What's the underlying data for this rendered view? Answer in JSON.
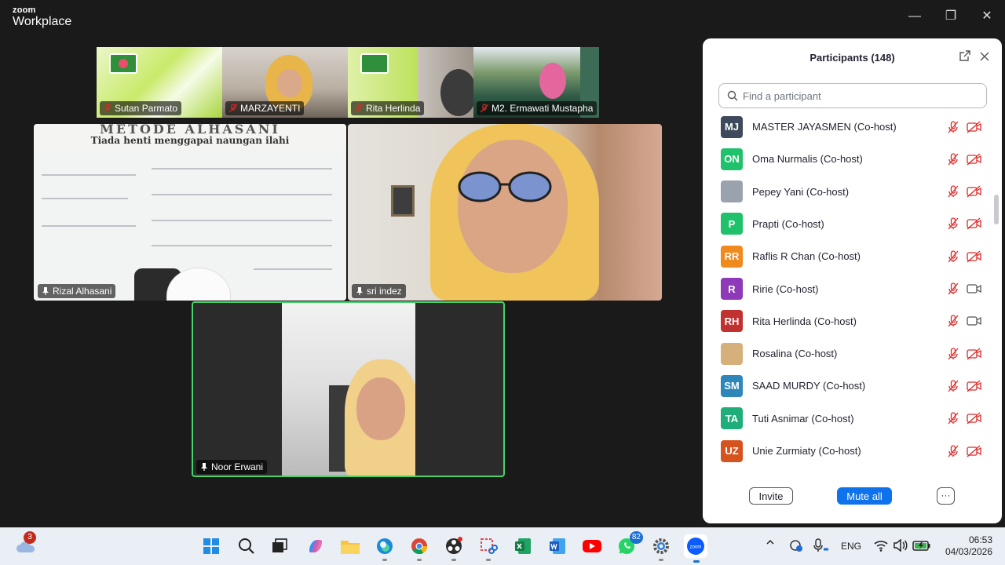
{
  "app": {
    "brand_small": "zoom",
    "brand_big": "Workplace"
  },
  "window_controls": {
    "minimize": "—",
    "restore": "❐",
    "close": "✕"
  },
  "strip_tiles": [
    {
      "name": "Sutan Parmato"
    },
    {
      "name": "MARZAYENTI"
    },
    {
      "name": "Rita Herlinda"
    },
    {
      "name": "M2. Ermawati Mustapha"
    }
  ],
  "main_tiles": {
    "rizal": {
      "name": "Rizal Alhasani",
      "banner_line1": "METODE ALHASANI",
      "banner_line2": "Tiada henti menggapai naungan ilahi"
    },
    "sri": {
      "name": "sri indez"
    },
    "noor": {
      "name": "Noor Erwani"
    }
  },
  "panel": {
    "title": "Participants (148)",
    "search_placeholder": "Find a participant",
    "invite_label": "Invite",
    "mute_all_label": "Mute all",
    "more_label": "···",
    "participants": [
      {
        "initials": "MJ",
        "name": "MASTER JAYASMEN (Co-host)",
        "color": "#3d4a5c",
        "video": "off"
      },
      {
        "initials": "ON",
        "name": "Oma Nurmalis (Co-host)",
        "color": "#1fc16b",
        "video": "off"
      },
      {
        "initials": "",
        "name": "Pepey Yani (Co-host)",
        "color": "#9aa3ad",
        "video": "off",
        "photo": true
      },
      {
        "initials": "P",
        "name": "Prapti (Co-host)",
        "color": "#1fc16b",
        "video": "off"
      },
      {
        "initials": "RR",
        "name": "Raflis R Chan (Co-host)",
        "color": "#f08a1c",
        "video": "off"
      },
      {
        "initials": "R",
        "name": "Ririe (Co-host)",
        "color": "#8e3ab8",
        "video": "on"
      },
      {
        "initials": "RH",
        "name": "Rita Herlinda (Co-host)",
        "color": "#c0312f",
        "video": "on"
      },
      {
        "initials": "",
        "name": "Rosalina (Co-host)",
        "color": "#d6b07a",
        "video": "off",
        "photo": true
      },
      {
        "initials": "SM",
        "name": "SAAD MURDY (Co-host)",
        "color": "#2f86b8",
        "video": "off"
      },
      {
        "initials": "TA",
        "name": "Tuti Asnimar (Co-host)",
        "color": "#1fae7a",
        "video": "off"
      },
      {
        "initials": "UZ",
        "name": "Unie Zurmiaty (Co-host)",
        "color": "#d5531f",
        "video": "off"
      }
    ]
  },
  "taskbar": {
    "weather_badge": "3",
    "whatsapp_badge": "82",
    "language": "ENG",
    "time": "06:53",
    "date": "04/03/2026"
  },
  "colors": {
    "accent": "#0e72ed",
    "active_speaker": "#45d36b",
    "mute_red": "#e02828"
  }
}
